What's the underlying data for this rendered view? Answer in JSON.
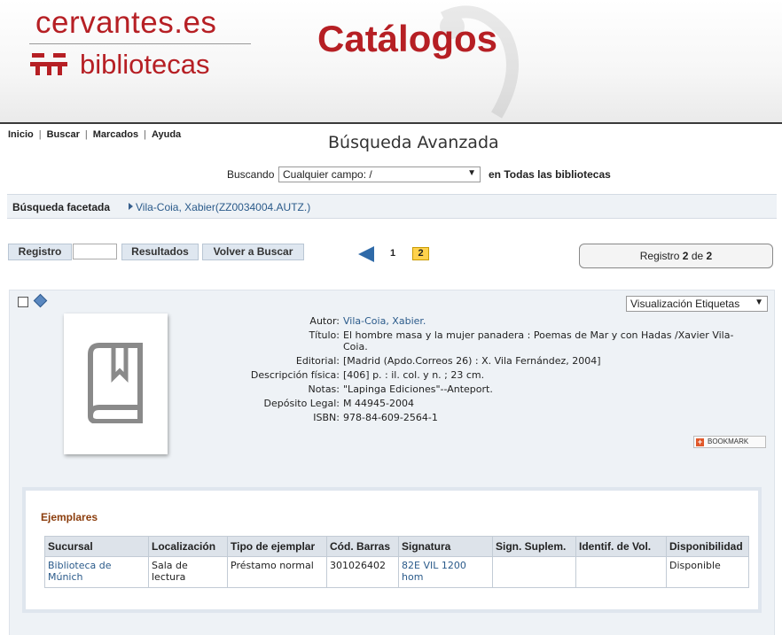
{
  "header": {
    "brand_top": "cervantes.es",
    "brand_bottom": "bibliotecas",
    "catalog_title": "Catálogos"
  },
  "nav": {
    "items": [
      "Inicio",
      "Buscar",
      "Marcados",
      "Ayuda"
    ]
  },
  "page": {
    "title": "Búsqueda Avanzada"
  },
  "search": {
    "label": "Buscando",
    "field_value": "Cualquier campo: /",
    "scope": "en Todas las bibliotecas"
  },
  "facet": {
    "label": "Búsqueda facetada",
    "value": "Vila-Coia, Xabier(ZZ0034004.AUTZ.)"
  },
  "toolbar": {
    "registro_label": "Registro",
    "registro_value": "",
    "resultados_label": "Resultados",
    "volver_label": "Volver a Buscar"
  },
  "pagination": {
    "pages": [
      "1",
      "2"
    ],
    "current": "2"
  },
  "record_counter": {
    "prefix": "Registro",
    "current": "2",
    "of": "de",
    "total": "2"
  },
  "view": {
    "selected": "Visualización Etiquetas"
  },
  "record": {
    "fields": [
      {
        "key": "Autor:",
        "value": "Vila-Coia, Xabier."
      },
      {
        "key": "Título:",
        "value": "El hombre masa y la mujer panadera : Poemas de Mar y con Hadas /Xavier Vila-Coia."
      },
      {
        "key": "Editorial:",
        "value": "[Madrid (Apdo.Correos 26) : X. Vila Fernández, 2004]"
      },
      {
        "key": "Descripción física:",
        "value": "[406] p. : il. col. y n. ; 23 cm."
      },
      {
        "key": "Notas:",
        "value": "\"Lapinga Ediciones\"--Anteport."
      },
      {
        "key": "Depósito Legal:",
        "value": "M 44945-2004"
      },
      {
        "key": "ISBN:",
        "value": "978-84-609-2564-1"
      }
    ],
    "bookmark_label": "BOOKMARK"
  },
  "holdings": {
    "title": "Ejemplares",
    "columns": [
      "Sucursal",
      "Localización",
      "Tipo de ejemplar",
      "Cód. Barras",
      "Signatura",
      "Sign. Suplem.",
      "Identif. de Vol.",
      "Disponibilidad"
    ],
    "rows": [
      [
        "Biblioteca de Múnich",
        "Sala de lectura",
        "Préstamo normal",
        "301026402",
        "82E VIL 1200 hom",
        "",
        "",
        "Disponible"
      ]
    ]
  },
  "colors": {
    "brand_red": "#b61f24",
    "link_blue": "#2a5a8a",
    "panel_bg": "#eef2f6",
    "current_page": "#ffd24d"
  }
}
